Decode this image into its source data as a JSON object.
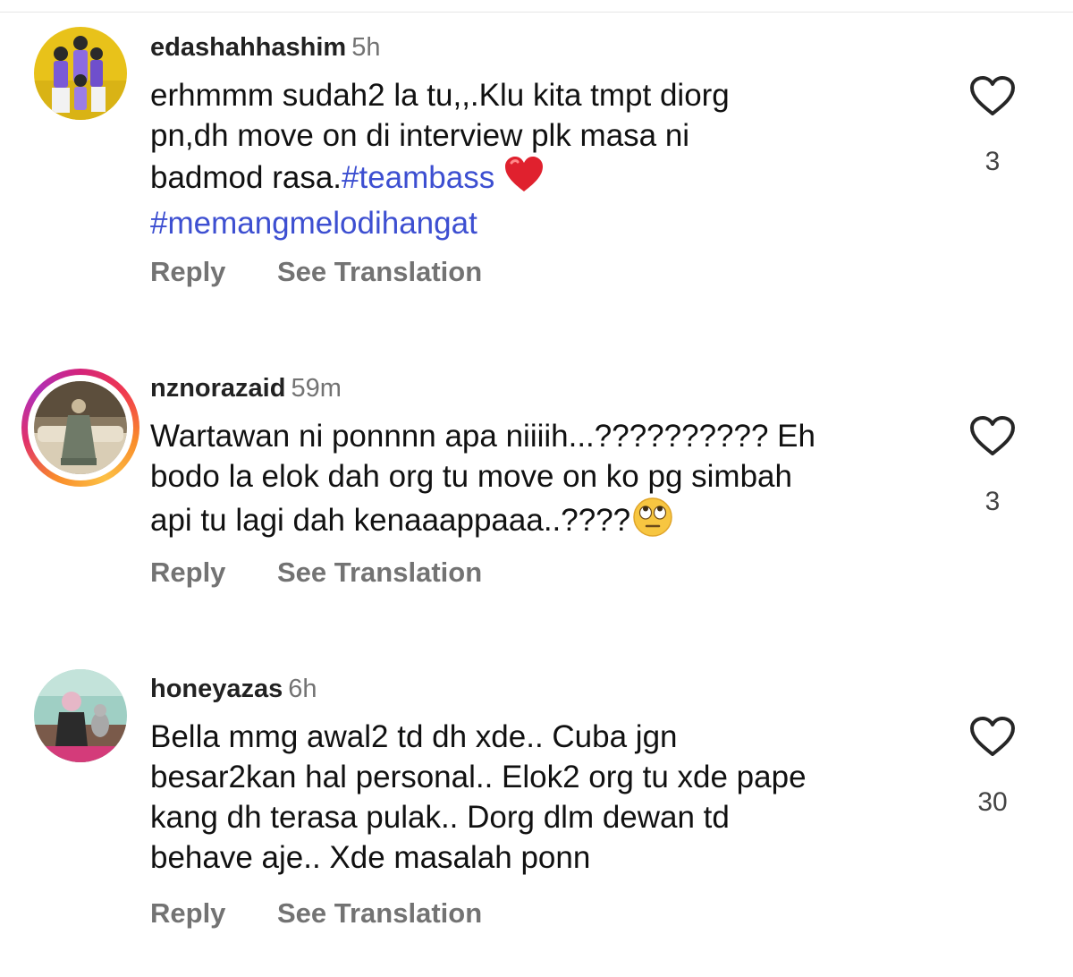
{
  "comments": [
    {
      "username": "edashahhashim",
      "time": "5h",
      "text_line1": "erhmmm sudah2 la tu,,.Klu kita tmpt diorg",
      "text_line2": "pn,dh move on di interview plk masa ni",
      "text_line3_prefix": "badmod rasa.",
      "hashtag1": "#teambass",
      "hashtag2": "#memangmelodihangat",
      "emoji": "red-heart",
      "likes": "3",
      "reply_label": "Reply",
      "translate_label": "See Translation",
      "has_story_ring": false
    },
    {
      "username": "nznorazaid",
      "time": "59m",
      "text_line1": "Wartawan ni ponnnn apa niiiih...?????????? Eh",
      "text_line2": "bodo la elok dah org tu move on ko pg simbah",
      "text_line3": "api tu lagi dah kenaaappaaa..????",
      "emoji": "face-with-rolling-eyes",
      "likes": "3",
      "reply_label": "Reply",
      "translate_label": "See Translation",
      "has_story_ring": true
    },
    {
      "username": "honeyazas",
      "time": "6h",
      "text_line1": "Bella mmg awal2 td dh xde.. Cuba jgn",
      "text_line2": "besar2kan hal personal.. Elok2 org tu xde pape",
      "text_line3": "kang dh terasa pulak.. Dorg dlm dewan td",
      "text_line4": "behave aje.. Xde masalah ponn",
      "likes": "30",
      "reply_label": "Reply",
      "translate_label": "See Translation",
      "has_story_ring": false
    }
  ],
  "colors": {
    "hashtag": "#3d4fd1",
    "secondary_text": "#737373",
    "primary_text": "#111111"
  },
  "icons": [
    "heart-outline-icon",
    "red-heart-emoji",
    "rolling-eyes-emoji"
  ]
}
